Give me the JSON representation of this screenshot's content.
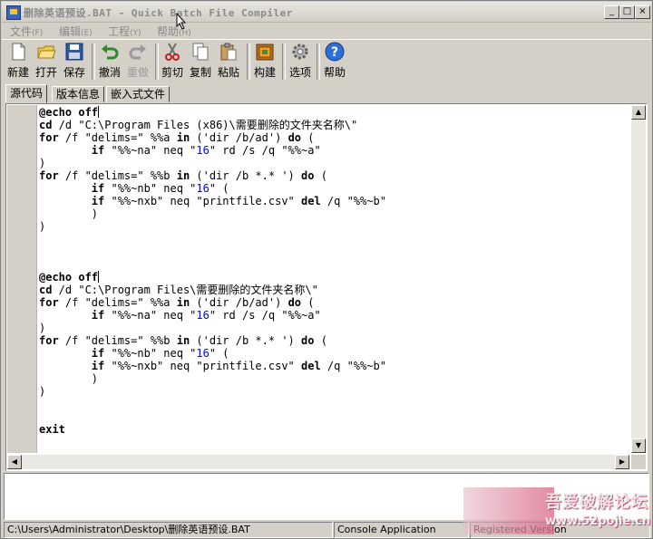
{
  "window": {
    "title": "删除英语预设.BAT - Quick Batch File Compiler",
    "minimize": "_",
    "maximize": "□",
    "close": "×"
  },
  "menu": [
    {
      "label": "文件",
      "acc": "(F)"
    },
    {
      "label": "编辑",
      "acc": "(E)"
    },
    {
      "label": "工程",
      "acc": "(Y)"
    },
    {
      "label": "帮助",
      "acc": "(H)"
    }
  ],
  "toolbar": {
    "new": "新建",
    "open": "打开",
    "save": "保存",
    "undo": "撤消",
    "redo": "重做",
    "cut": "剪切",
    "copy": "复制",
    "paste": "粘贴",
    "build": "构建",
    "options": "选项",
    "help": "帮助"
  },
  "tabs": [
    "源代码",
    "版本信息",
    "嵌入式文件"
  ],
  "editor": {
    "lines": [
      "@echo off",
      "cd /d \"C:\\Program Files (x86)\\需要删除的文件夹名称\\\"",
      "for /f \"delims=\" %%a in ('dir /b/ad') do (",
      "        if \"%%~na\" neq \"16\" rd /s /q \"%%~a\"",
      ")",
      "for /f \"delims=\" %%b in ('dir /b *.* ') do (",
      "        if \"%%~nb\" neq \"16\" (",
      "        if \"%%~nxb\" neq \"printfile.csv\" del /q \"%%~b\"",
      "        )",
      ")",
      "",
      "",
      "",
      "@echo off",
      "cd /d \"C:\\Program Files\\需要删除的文件夹名称\\\"",
      "for /f \"delims=\" %%a in ('dir /b/ad') do (",
      "        if \"%%~na\" neq \"16\" rd /s /q \"%%~a\"",
      ")",
      "for /f \"delims=\" %%b in ('dir /b *.* ') do (",
      "        if \"%%~nb\" neq \"16\" (",
      "        if \"%%~nxb\" neq \"printfile.csv\" del /q \"%%~b\"",
      "        )",
      ")",
      "",
      "",
      "exit"
    ]
  },
  "status": {
    "path": "C:\\Users\\Administrator\\Desktop\\删除英语预设.BAT",
    "app_type": "Console Application",
    "registered": "Registered Version"
  },
  "watermark": {
    "text": "吾爱破解论坛",
    "url": "www.52pojie.cn"
  },
  "colors": {
    "number": "#0000ff",
    "chrome": "#d4d0c8"
  }
}
